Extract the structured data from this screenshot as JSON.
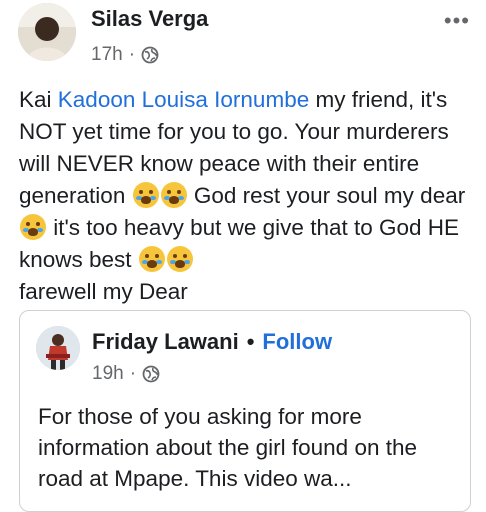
{
  "post": {
    "author": "Silas Verga",
    "time": "17h",
    "dot": "·",
    "privacy_icon": "globe-icon",
    "more_icon": "more-options-icon",
    "text": {
      "prefix": "Kai ",
      "mention": "Kadoon Louisa Iornumbe",
      "part1": " my friend, it's  NOT yet time for you to go. Your murderers will NEVER know peace with their entire generation ",
      "part2": " God rest your soul my dear",
      "part3": " it's too heavy but we give that to God HE knows best ",
      "part4": " farewell my Dear",
      "emoji_name": "crying-face-emoji"
    }
  },
  "shared_post": {
    "author": "Friday Lawani",
    "separator": "•",
    "follow_label": "Follow",
    "time": "19h",
    "dot": "·",
    "privacy_icon": "globe-icon",
    "text": "For those of you asking for more information about the girl found on the road at Mpape.  This video wa..."
  },
  "colors": {
    "link": "#216fdb",
    "meta": "#65676b",
    "text": "#1c1e21",
    "border": "#ced0d4"
  }
}
